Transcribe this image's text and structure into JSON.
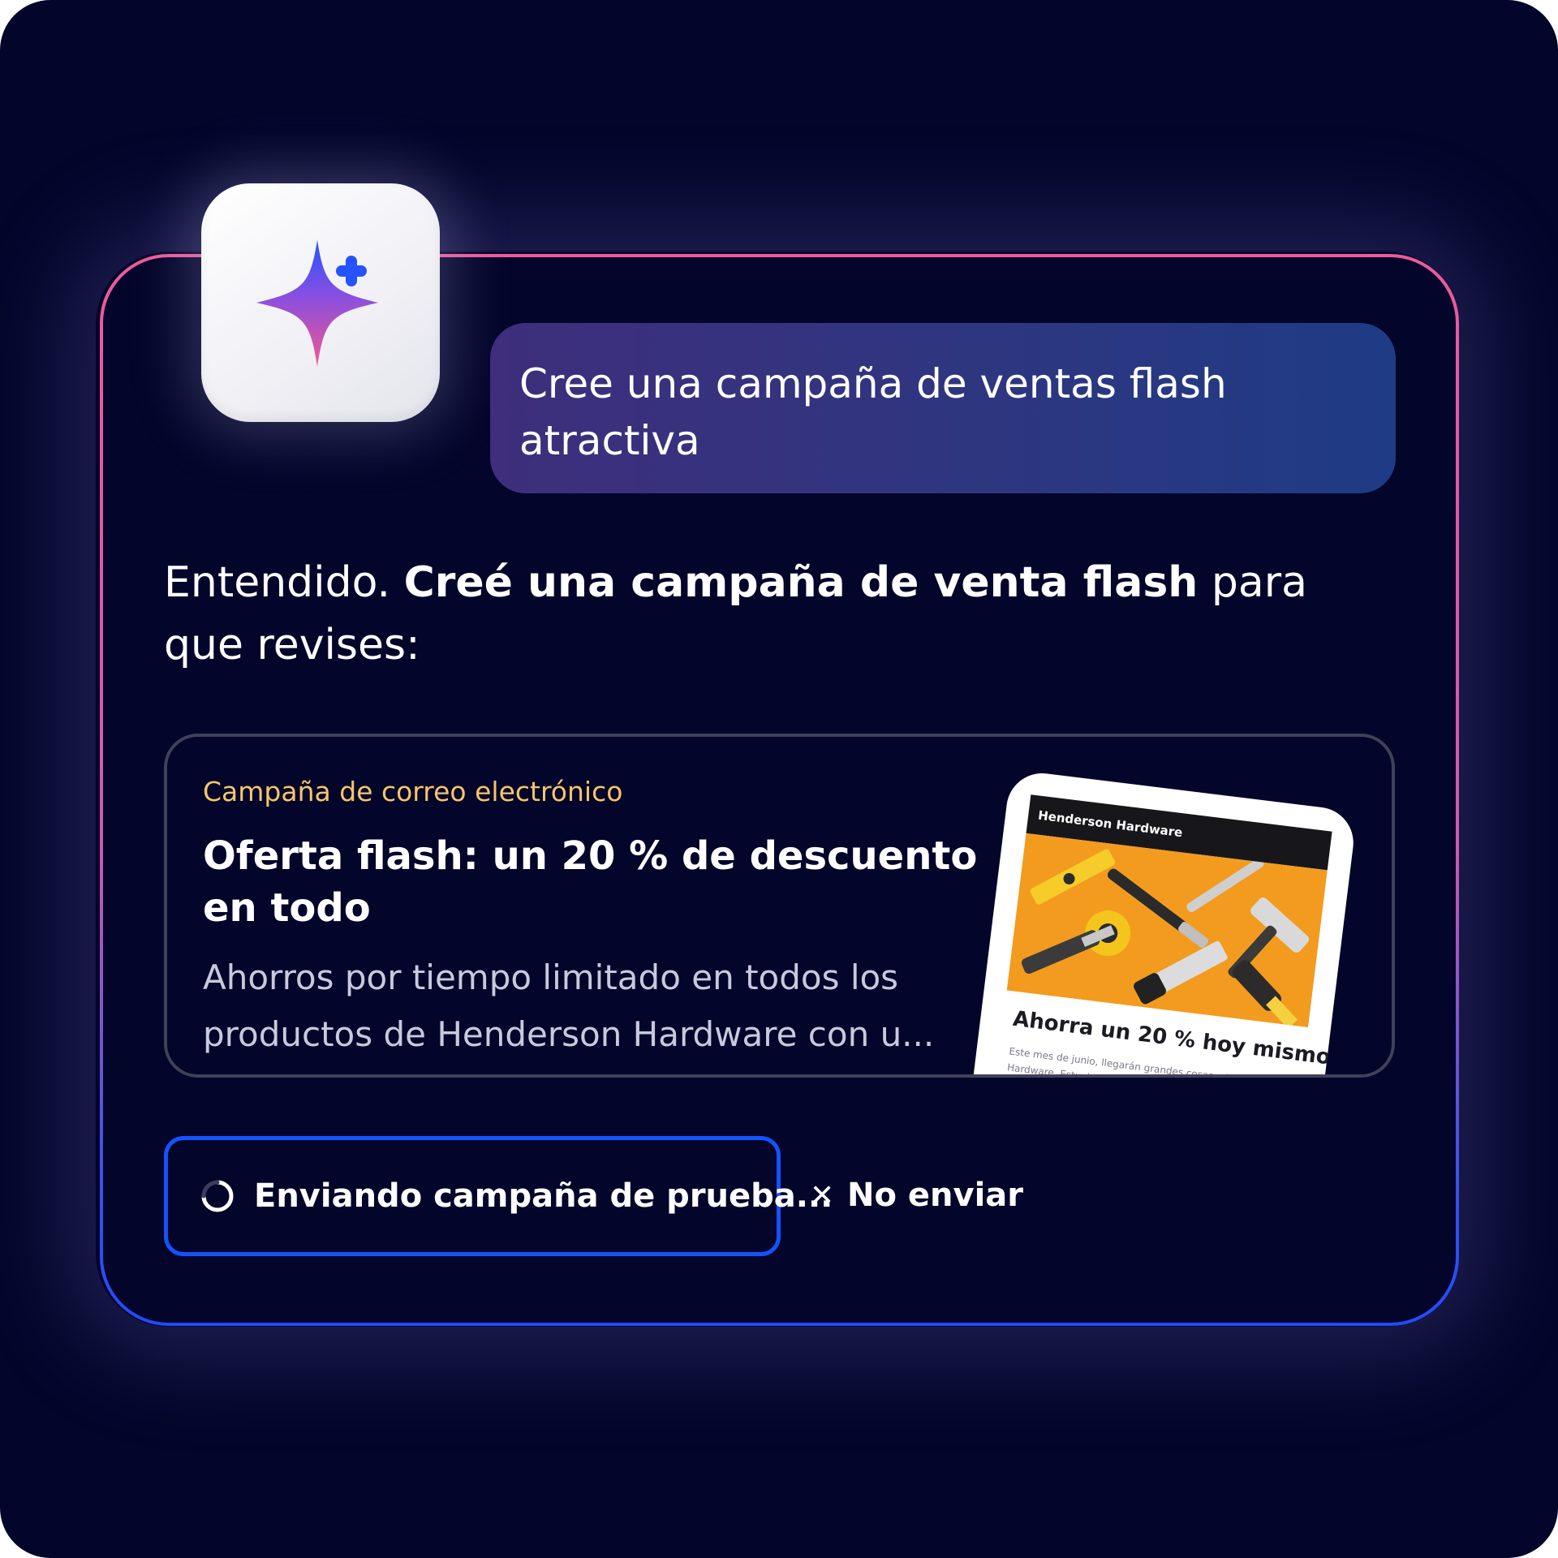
{
  "prompt": {
    "text": "Cree una campaña de ventas flash atractiva"
  },
  "response": {
    "prefix": "Entendido. ",
    "bold": "Creé una campaña de venta flash",
    "suffix": " para que revises:"
  },
  "campaign_card": {
    "type_label": "Campaña de correo electrónico",
    "title": "Oferta flash: un 20 % de descuento en todo",
    "description": "Ahorros por tiempo limitado en todos los productos de Henderson Hardware con u...",
    "preview": {
      "brand": "Henderson Hardware",
      "headline": "Ahorra un 20 % hoy mismo",
      "body": "Este mes de junio, llegarán grandes cosas a Henderson Hardware. Estuvimos"
    }
  },
  "actions": {
    "send_label": "Enviando campaña de prueba...",
    "cancel_icon": "close-icon",
    "cancel_label": "No enviar"
  },
  "colors": {
    "background": "#03052a",
    "accent_blue": "#1453ff",
    "eyebrow": "#f6c56c",
    "frame_pink": "#ee5a9c",
    "preview_orange": "#f39b1f"
  }
}
